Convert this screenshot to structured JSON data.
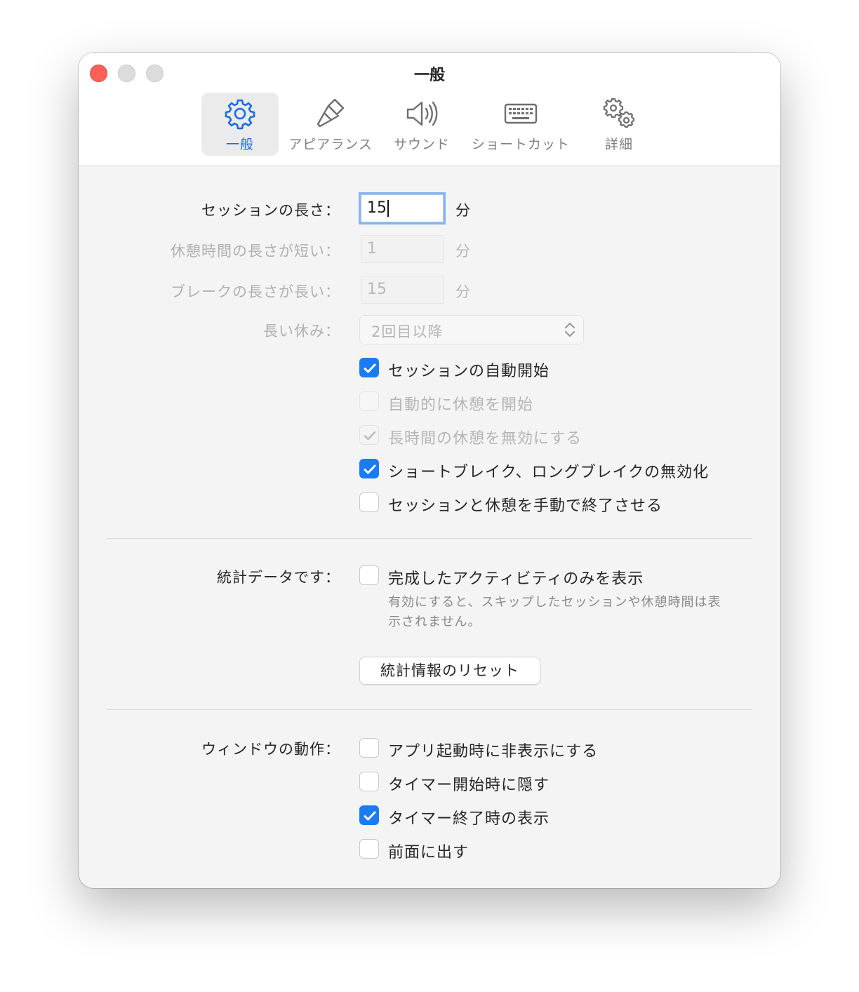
{
  "window": {
    "title": "一般"
  },
  "toolbar": {
    "tabs": [
      {
        "label": "一般",
        "icon": "gear-icon",
        "active": true
      },
      {
        "label": "アピアランス",
        "icon": "paintbrush-icon",
        "active": false
      },
      {
        "label": "サウンド",
        "icon": "speaker-icon",
        "active": false
      },
      {
        "label": "ショートカット",
        "icon": "keyboard-icon",
        "active": false
      },
      {
        "label": "詳細",
        "icon": "gears-icon",
        "active": false
      }
    ]
  },
  "durations": {
    "session": {
      "label": "セッションの長さ：",
      "value": "15",
      "unit": "分"
    },
    "short_break": {
      "label": "休憩時間の長さが短い：",
      "value": "1",
      "unit": "分"
    },
    "long_break": {
      "label": "ブレークの長さが長い：",
      "value": "15",
      "unit": "分"
    },
    "long_rest": {
      "label": "長い休み：",
      "selected": "2回目以降"
    }
  },
  "session_options": [
    {
      "label": "セッションの自動開始",
      "checked": true,
      "enabled": true
    },
    {
      "label": "自動的に休憩を開始",
      "checked": false,
      "enabled": false
    },
    {
      "label": "長時間の休憩を無効にする",
      "checked": true,
      "enabled": false
    },
    {
      "label": "ショートブレイク、ロングブレイクの無効化",
      "checked": true,
      "enabled": true
    },
    {
      "label": "セッションと休憩を手動で終了させる",
      "checked": false,
      "enabled": true
    }
  ],
  "stats": {
    "label": "統計データです：",
    "option": {
      "label": "完成したアクティビティのみを表示",
      "checked": false
    },
    "help_line1": "有効にすると、スキップしたセッションや休憩時間は表",
    "help_line2": "示されません。",
    "reset_button": "統計情報のリセット"
  },
  "window_behavior": {
    "label": "ウィンドウの動作：",
    "options": [
      {
        "label": "アプリ起動時に非表示にする",
        "checked": false
      },
      {
        "label": "タイマー開始時に隠す",
        "checked": false
      },
      {
        "label": "タイマー終了時の表示",
        "checked": true
      },
      {
        "label": "前面に出す",
        "checked": false
      }
    ]
  },
  "colors": {
    "accent": "#1a7cf4",
    "close": "#fe5f57"
  }
}
